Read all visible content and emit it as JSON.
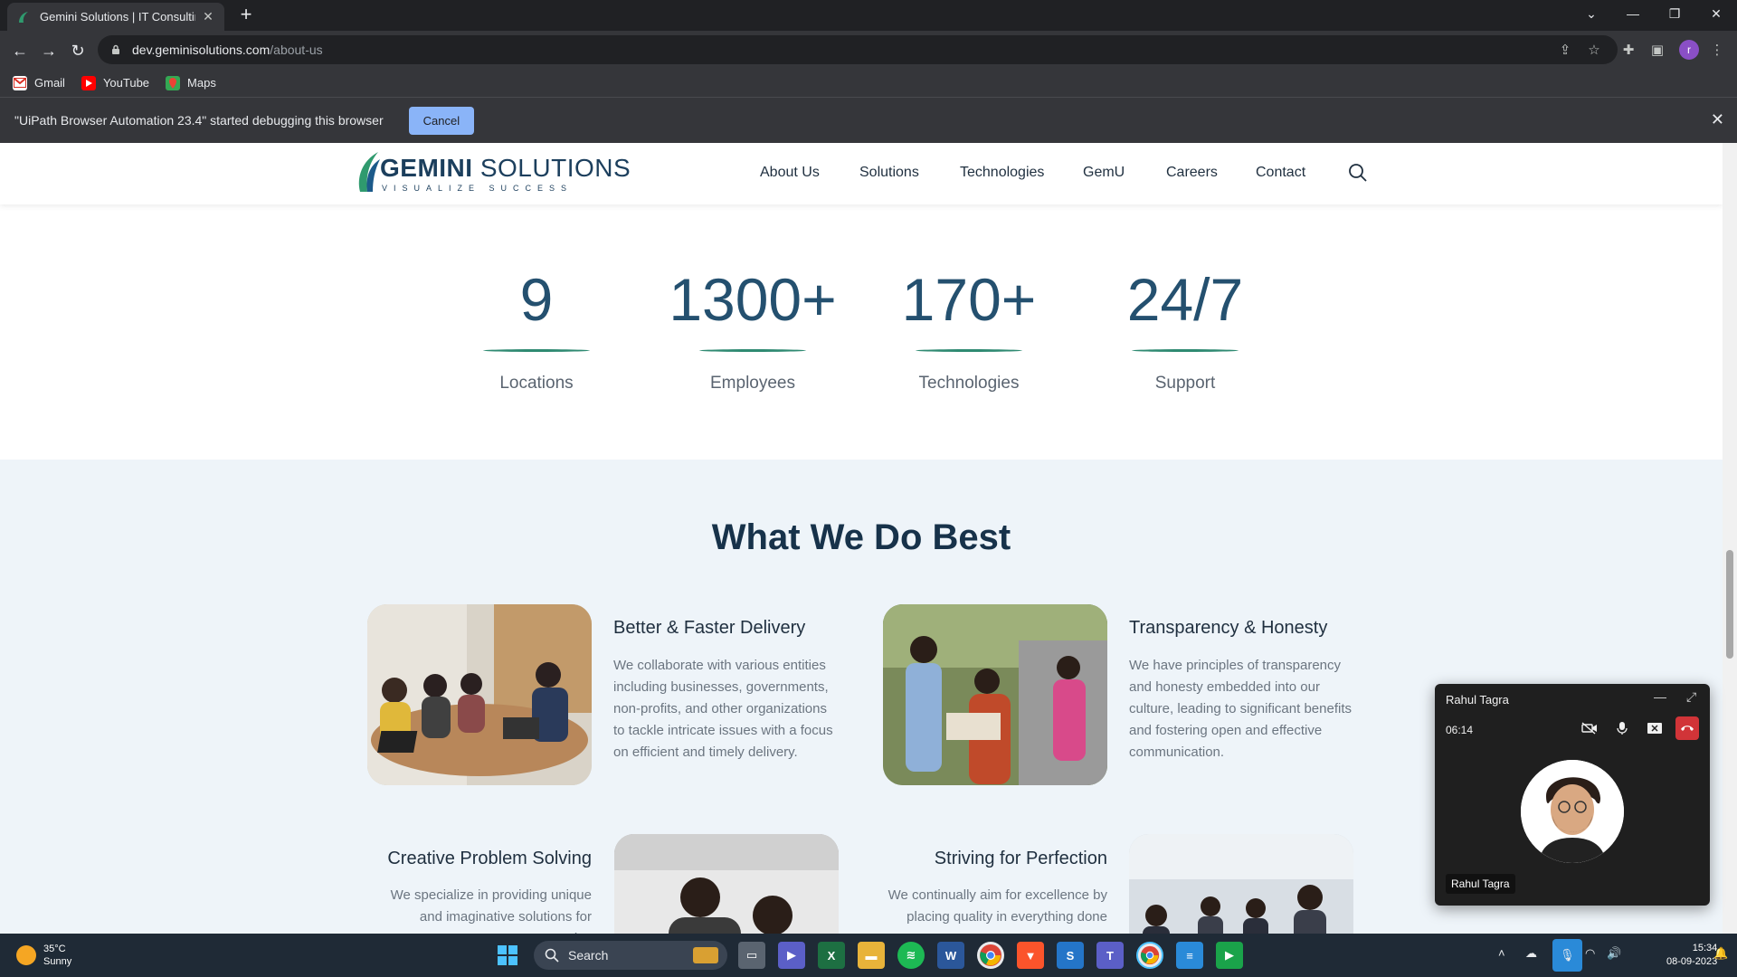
{
  "browser": {
    "tab_title": "Gemini Solutions | IT Consulting,",
    "url_host": "dev.geminisolutions.com",
    "url_path": "/about-us",
    "profile_initial": "r",
    "bookmarks": [
      {
        "label": "Gmail",
        "icon": "gmail-icon",
        "color": "#d93025"
      },
      {
        "label": "YouTube",
        "icon": "youtube-icon",
        "color": "#ff0000"
      },
      {
        "label": "Maps",
        "icon": "maps-icon",
        "color": "#34a853"
      }
    ],
    "infobar_text": "\"UiPath Browser Automation 23.4\" started debugging this browser",
    "infobar_cancel": "Cancel"
  },
  "site": {
    "logo_name_bold": "GEMINI",
    "logo_name_rest": " SOLUTIONS",
    "logo_tagline": "VISUALIZE SUCCESS",
    "nav": [
      "About Us",
      "Solutions",
      "Technologies",
      "GemU",
      "Careers",
      "Contact"
    ],
    "stats": [
      {
        "value": "9",
        "label": "Locations"
      },
      {
        "value": "1300+",
        "label": "Employees"
      },
      {
        "value": "170+",
        "label": "Technologies"
      },
      {
        "value": "24/7",
        "label": "Support"
      }
    ],
    "services_title": "What We Do Best",
    "cards": [
      {
        "title": "Better & Faster Delivery",
        "desc": "We collaborate with various entities including businesses, governments, non-profits, and other organizations to tackle intricate issues with a focus on efficient and timely delivery."
      },
      {
        "title": "Transparency & Honesty",
        "desc": "We have principles of transparency and honesty embedded into our culture, leading to significant benefits and fostering open and effective communication."
      },
      {
        "title": "Creative Problem Solving",
        "desc": "We specialize in providing unique and imaginative solutions for complex"
      },
      {
        "title": "Striving for Perfection",
        "desc": "We continually aim for excellence by placing quality in everything done"
      }
    ],
    "accent": "#2f8a72",
    "heading_color": "#24506f"
  },
  "call": {
    "caller": "Rahul Tagra",
    "duration": "06:14",
    "tag": "Rahul Tagra"
  },
  "taskbar": {
    "temp": "35°C",
    "weather": "Sunny",
    "search": "Search",
    "time": "15:34",
    "date": "08-09-2023"
  }
}
